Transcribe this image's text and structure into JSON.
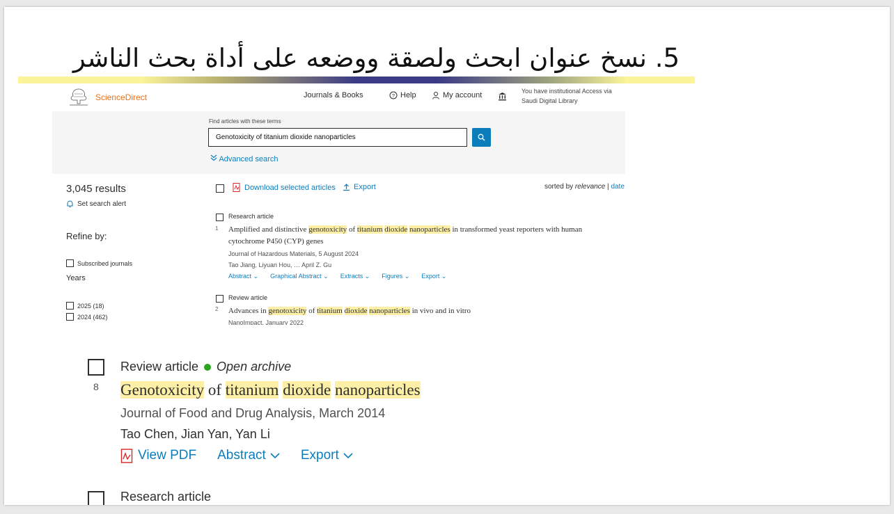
{
  "slide": {
    "title": "5. نسخ عنوان ابحث ولصقة ووضعه على أداة بحث الناشر"
  },
  "header": {
    "brand": "ScienceDirect",
    "nav_journals": "Journals & Books",
    "nav_help": "Help",
    "nav_account": "My account",
    "institution_line1": "You have institutional Access via",
    "institution_line2": "Saudi Digital Library"
  },
  "search": {
    "label": "Find articles with these terms",
    "value": "Genotoxicity of titanium dioxide nanoparticles",
    "advanced": "Advanced search"
  },
  "sidebar": {
    "results": "3,045 results",
    "alert": "Set search alert",
    "refine": "Refine by:",
    "subscribed": "Subscribed journals",
    "years_label": "Years",
    "years": [
      {
        "label": "2025 (18)"
      },
      {
        "label": "2024 (462)"
      }
    ]
  },
  "toolbar": {
    "download": "Download selected articles",
    "export": "Export",
    "sorted_prefix": "sorted by ",
    "sorted_relevance": "relevance",
    "sorted_sep": " | ",
    "sorted_date": "date"
  },
  "articles": [
    {
      "type": "Research article",
      "number": "1",
      "title_parts": [
        "Amplified and distinctive ",
        "genotoxicity",
        " of ",
        "titanium",
        " ",
        "dioxide",
        " ",
        "nanoparticles",
        " in transformed yeast reporters with human"
      ],
      "title_line2": "cytochrome P450 (CYP) genes",
      "journal": "Journal of Hazardous Materials, 5 August 2024",
      "authors": "Tao Jiang, Liyuan Hou, … April Z. Gu",
      "links": [
        "Abstract",
        "Graphical Abstract",
        "Extracts",
        "Figures",
        "Export"
      ]
    },
    {
      "type": "Review article",
      "number": "2",
      "title_parts": [
        "Advances in ",
        "genotoxicity",
        " of ",
        "titanium",
        " ",
        "dioxide",
        " ",
        "nanoparticles",
        " in vivo and in vitro"
      ],
      "journal": "NanoImpact, January 2022"
    }
  ],
  "zoomed": {
    "type": "Review article",
    "open": "Open archive",
    "number": "8",
    "title_parts": [
      "Genotoxicity",
      " of ",
      "titanium",
      " ",
      "dioxide",
      " ",
      "nanoparticles"
    ],
    "journal": "Journal of Food and Drug Analysis, March 2014",
    "authors": "Tao Chen, Jian Yan, Yan Li",
    "view_pdf": "View PDF",
    "abstract": "Abstract",
    "export": "Export",
    "next_type": "Research article"
  },
  "colors": {
    "brand_orange": "#e9711c",
    "link_blue": "#0c7dbb",
    "highlight": "#fdf0a6",
    "open_green": "#29a61b"
  }
}
